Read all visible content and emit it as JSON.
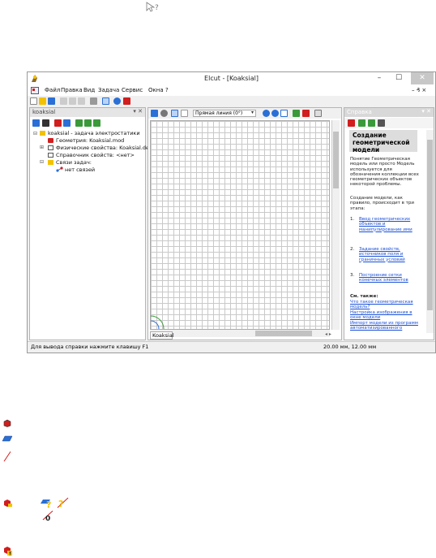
{
  "window": {
    "title": "Elcut - [Koaksial]",
    "controls": {
      "minimize": "–",
      "maximize": "☐",
      "close": "✕"
    }
  },
  "menu": {
    "items": [
      "Файл",
      "Правка",
      "Вид",
      "Задача",
      "Сервис",
      "Окна",
      "?"
    ],
    "mdi_controls": "– ₰ ×"
  },
  "left_panel": {
    "title": "koaksial",
    "tree": [
      {
        "label": "koaksial - задача электростатики"
      },
      {
        "label": "Геометрия: Koaksial.mod"
      },
      {
        "label": "Физические свойства: Koaksial.des"
      },
      {
        "label": "Справочник свойств: <нет>"
      },
      {
        "label": "Связи задач:"
      },
      {
        "label": "нет связей"
      }
    ]
  },
  "center_panel": {
    "line_type_select": "Прямая линия (0°)",
    "tab": "Koaksial"
  },
  "right_panel": {
    "title": "Справка",
    "heading": "Создание геометрической модели",
    "para1": "Понятие Геометрическая модель или просто Модель используется для обозначения коллекции всех геометрических объектов некоторой проблемы.",
    "para2": "Создание модели, как правило, происходит в три этапа:",
    "steps": [
      {
        "num": "1.",
        "text": "Ввод геометрических объектов и манипулирование ими"
      },
      {
        "num": "2.",
        "text": "Задание свойств, источников поля и граничных условий"
      },
      {
        "num": "3.",
        "text": "Построение сетки конечных элементов"
      }
    ],
    "see_also": "См. также:",
    "links": [
      "Что такое геометрическая модель?",
      "Настройка изображения в окне модели",
      "Импорт модели из программ автоматизированного"
    ]
  },
  "status": {
    "left": "Для вывода справки нажмите клавишу F1",
    "right": "20.00 мм, 12.00 мм"
  },
  "colors": {
    "accent_red": "#d11e1e",
    "link": "#1a4fd6",
    "icon_yellow": "#f2c200",
    "icon_blue": "#2a6fd6"
  }
}
